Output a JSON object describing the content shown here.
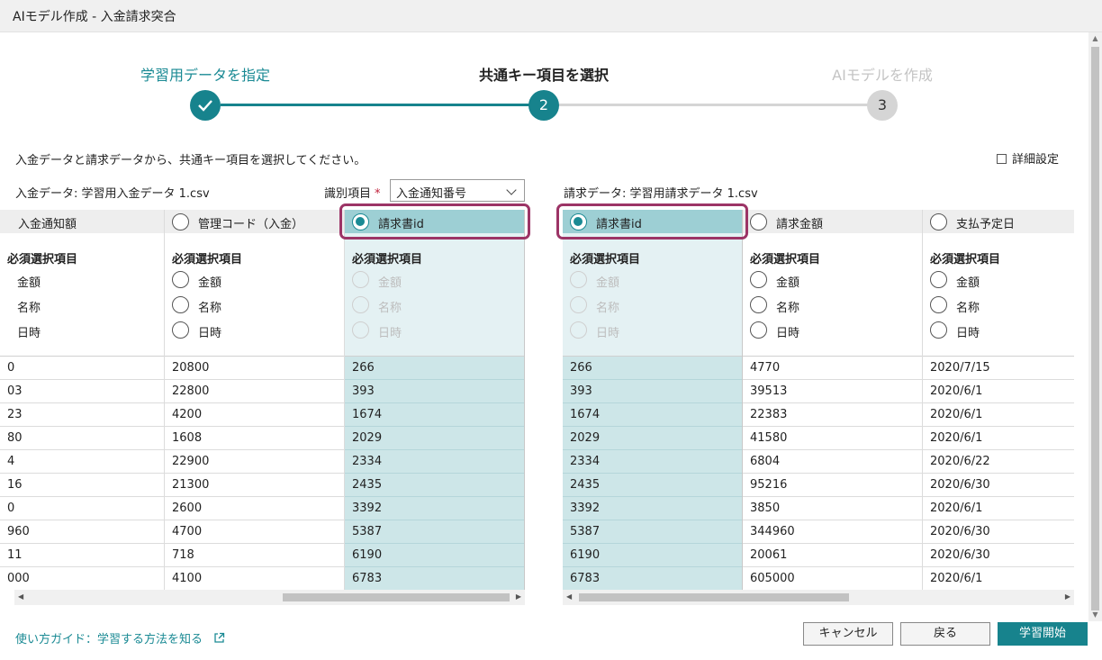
{
  "window": {
    "title": "AIモデル作成 - 入金請求突合"
  },
  "steps": [
    {
      "label": "学習用データを指定",
      "number": "",
      "state": "done"
    },
    {
      "label": "共通キー項目を選択",
      "number": "2",
      "state": "current"
    },
    {
      "label": "AIモデルを作成",
      "number": "3",
      "state": "pending"
    }
  ],
  "instruction": "入金データと請求データから、共通キー項目を選択してください。",
  "detail_settings": "詳細設定",
  "left": {
    "title": "入金データ: 学習用入金データ 1.csv",
    "ident_label": "識別項目",
    "ident_required": "*",
    "ident_value": "入金通知番号",
    "sub_title": "必須選択項目",
    "options": [
      "金額",
      "名称",
      "日時"
    ],
    "columns": [
      {
        "header": "入金通知額",
        "rows": [
          "0",
          "03",
          "23",
          "80",
          "4",
          "16",
          "0",
          "960",
          "11",
          "000"
        ]
      },
      {
        "header": "管理コード（入金）",
        "rows": [
          "20800",
          "22800",
          "4200",
          "1608",
          "22900",
          "21300",
          "2600",
          "4700",
          "718",
          "4100"
        ]
      },
      {
        "header": "請求書id",
        "rows": [
          "266",
          "393",
          "1674",
          "2029",
          "2334",
          "2435",
          "3392",
          "5387",
          "6190",
          "6783"
        ]
      }
    ]
  },
  "right": {
    "title": "請求データ: 学習用請求データ 1.csv",
    "sub_title": "必須選択項目",
    "options": [
      "金額",
      "名称",
      "日時"
    ],
    "columns": [
      {
        "header": "請求書id",
        "rows": [
          "266",
          "393",
          "1674",
          "2029",
          "2334",
          "2435",
          "3392",
          "5387",
          "6190",
          "6783"
        ]
      },
      {
        "header": "請求金額",
        "rows": [
          "4770",
          "39513",
          "22383",
          "41580",
          "6804",
          "95216",
          "3850",
          "344960",
          "20061",
          "605000"
        ]
      },
      {
        "header": "支払予定日",
        "rows": [
          "2020/7/15",
          "2020/6/1",
          "2020/6/1",
          "2020/6/1",
          "2020/6/22",
          "2020/6/30",
          "2020/6/1",
          "2020/6/30",
          "2020/6/30",
          "2020/6/1"
        ]
      }
    ]
  },
  "footer": {
    "guide": "使い方ガイド：学習する方法を知る",
    "cancel": "キャンセル",
    "back": "戻る",
    "start": "学習開始"
  },
  "colors": {
    "accent": "#17838d",
    "highlight": "#9c3466",
    "pending": "#d5d5d5"
  }
}
